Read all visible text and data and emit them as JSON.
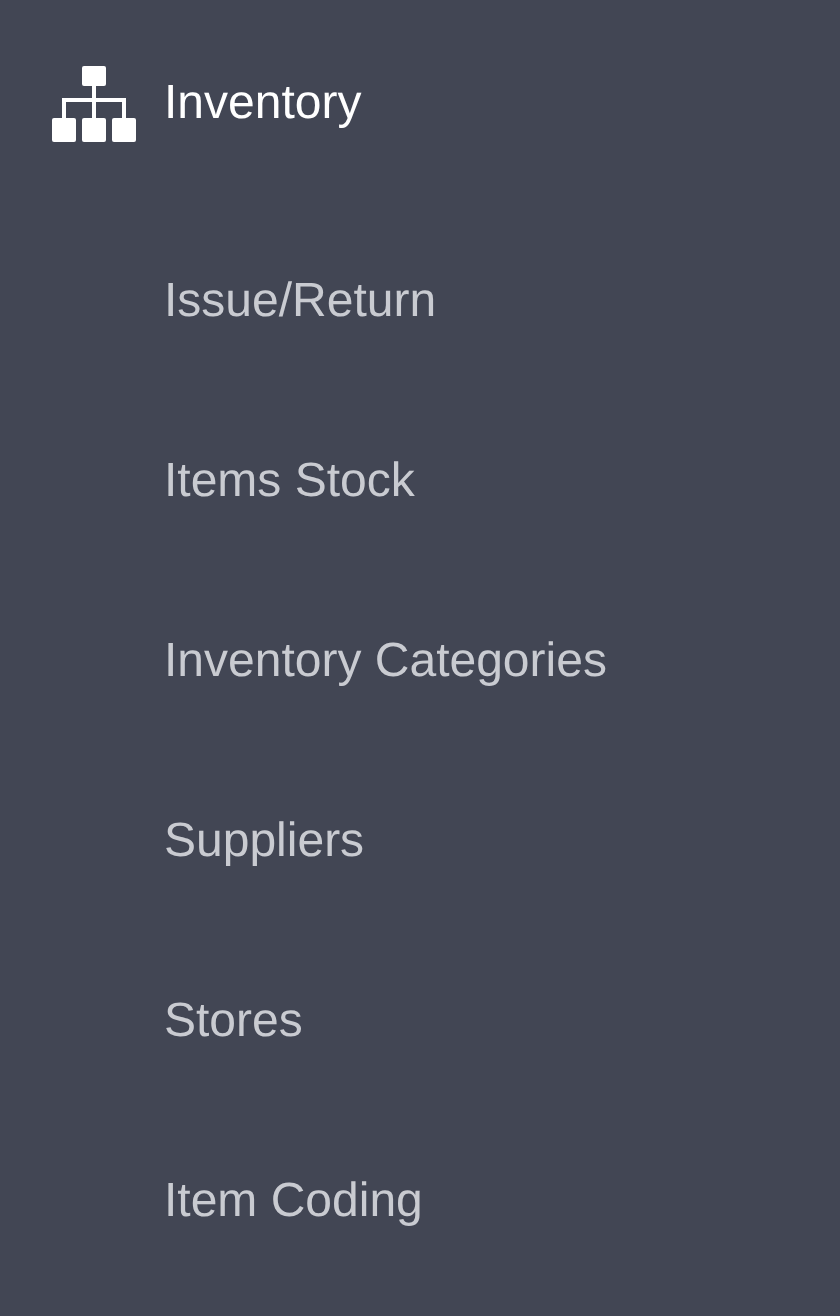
{
  "section": {
    "title": "Inventory"
  },
  "items": [
    {
      "label": "Issue/Return"
    },
    {
      "label": "Items Stock"
    },
    {
      "label": "Inventory Categories"
    },
    {
      "label": "Suppliers"
    },
    {
      "label": "Stores"
    },
    {
      "label": "Item Coding"
    }
  ]
}
